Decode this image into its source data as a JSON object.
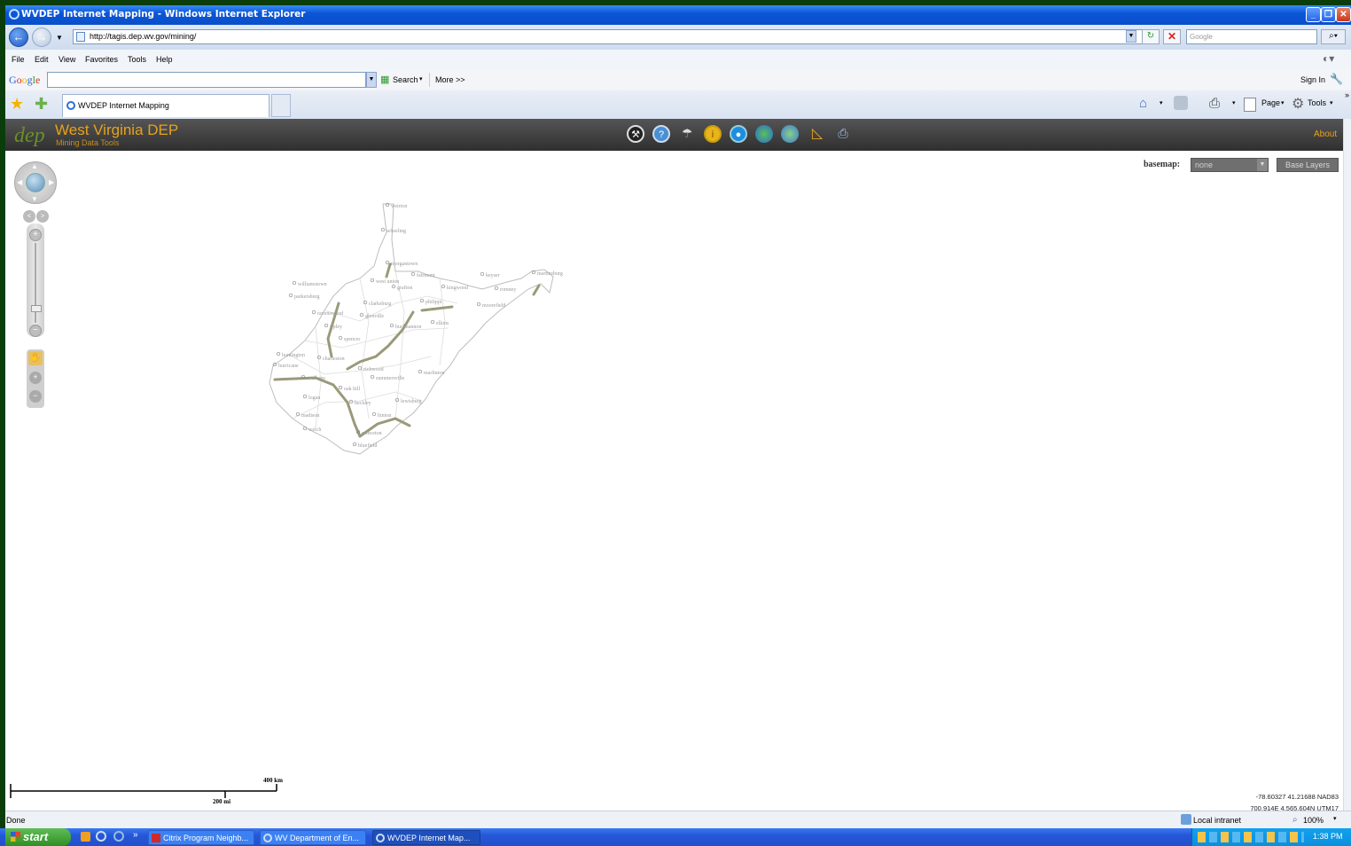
{
  "window": {
    "title": "WVDEP Internet Mapping - Windows Internet Explorer",
    "url": "http://tagis.dep.wv.gov/mining/",
    "search_placeholder": "Google"
  },
  "menu": [
    "File",
    "Edit",
    "View",
    "Favorites",
    "Tools",
    "Help"
  ],
  "google_toolbar": {
    "logo": "Google",
    "search_label": "Search",
    "more_label": "More >>",
    "sign_in": "Sign In"
  },
  "tab": {
    "label": "WVDEP Internet Mapping"
  },
  "commands": {
    "page": "Page",
    "tools": "Tools"
  },
  "app": {
    "logo_text": "dep",
    "title": "West Virginia DEP",
    "subtitle": "Mining Data Tools",
    "about": "About",
    "basemap_label": "basemap:",
    "basemap_value": "none",
    "base_layers_button": "Base Layers",
    "scale_km": "400 km",
    "scale_mi": "200 mi",
    "coords_line1": "-78.60327 41.21688 NAD83",
    "coords_line2": "700,914E 4,565,604N UTM17"
  },
  "map_labels": [
    "weirton",
    "wheeling",
    "morgantown",
    "williamstown",
    "parkersburg",
    "west union",
    "grafton",
    "fairmont",
    "kingwood",
    "keyser",
    "romney",
    "martinsburg",
    "clarksburg",
    "philippi",
    "moorefield",
    "ravenswood",
    "glenville",
    "ripley",
    "buckhannon",
    "elkins",
    "spencer",
    "huntington",
    "charleston",
    "hurricane",
    "richwood",
    "marlinton",
    "st albans",
    "summersville",
    "oak hill",
    "logan",
    "beckley",
    "lewisburg",
    "hinton",
    "welch",
    "princeton",
    "bluefield",
    "madison"
  ],
  "status": {
    "left": "Done",
    "zone": "Local intranet",
    "zoom": "100%"
  },
  "taskbar": {
    "start": "start",
    "items": [
      "Citrix Program Neighb...",
      "WV Department of En...",
      "WVDEP Internet Map..."
    ],
    "clock": "1:38 PM"
  },
  "colors": {
    "header_bg": "#3a3a3a",
    "brand_orange": "#e8a21a",
    "title_blue": "#0a4fc9",
    "taskbar_blue": "#2457d8"
  }
}
